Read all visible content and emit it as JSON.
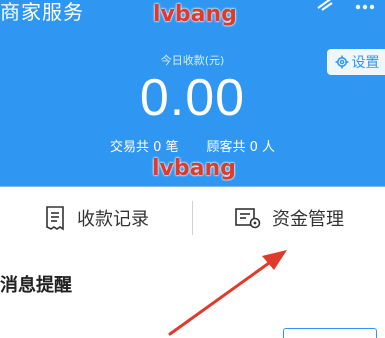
{
  "header": {
    "title": "商家服务",
    "icons": [
      "grid-icon",
      "more-icon"
    ]
  },
  "summary": {
    "today_label": "今日收款(元)",
    "amount": "0.00",
    "transactions": "交易共 0 笔",
    "customers": "顾客共 0 人",
    "settings_label": "设置"
  },
  "actions": [
    {
      "label": "收款记录",
      "icon": "receipt-icon"
    },
    {
      "label": "资金管理",
      "icon": "fund-management-icon"
    }
  ],
  "notice": {
    "title": "消息提醒",
    "item_text": "",
    "item_button": ""
  },
  "watermarks": [
    "lvbang",
    "lvbang"
  ],
  "colors": {
    "primary": "#2f97f2",
    "watermark": "#e03a2a",
    "arrow": "#e03a2a"
  }
}
